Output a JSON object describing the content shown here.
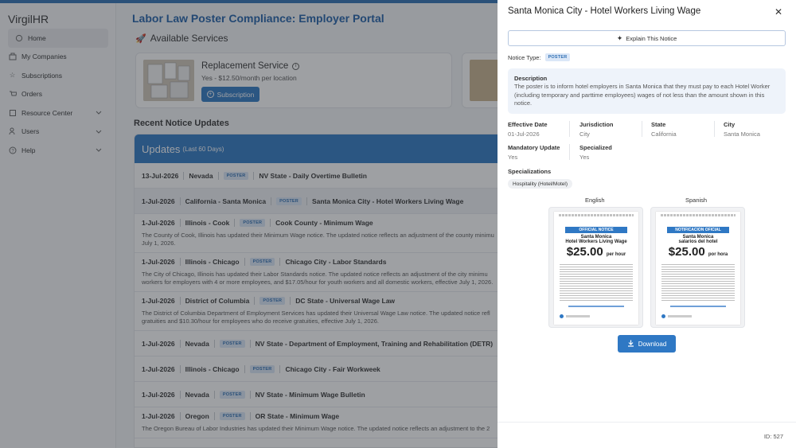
{
  "sidebar": {
    "brand": "VirgilHR",
    "items": [
      {
        "label": "Home",
        "icon": "home-icon",
        "active": true,
        "expandable": false
      },
      {
        "label": "My Companies",
        "icon": "building-icon",
        "active": false,
        "expandable": false
      },
      {
        "label": "Subscriptions",
        "icon": "star-icon",
        "active": false,
        "expandable": false
      },
      {
        "label": "Orders",
        "icon": "cart-icon",
        "active": false,
        "expandable": false
      },
      {
        "label": "Resource Center",
        "icon": "book-icon",
        "active": false,
        "expandable": true
      },
      {
        "label": "Users",
        "icon": "users-icon",
        "active": false,
        "expandable": true
      },
      {
        "label": "Help",
        "icon": "help-icon",
        "active": false,
        "expandable": true
      }
    ]
  },
  "main": {
    "title": "Labor Law Poster Compliance: Employer Portal",
    "available_services": "Available Services",
    "service": {
      "title": "Replacement Service",
      "price": "Yes - $12.50/month per location",
      "button": "Subscription"
    },
    "recent_title": "Recent Notice Updates",
    "updates_title": "Updates",
    "updates_sub": "(Last 60 Days)",
    "rows": [
      {
        "date": "13-Jul-2026",
        "loc": "Nevada",
        "badge": "POSTER",
        "title": "NV State - Daily Overtime Bulletin",
        "desc": []
      },
      {
        "date": "1-Jul-2026",
        "loc": "California - Santa Monica",
        "badge": "POSTER",
        "title": "Santa Monica City - Hotel Workers Living Wage",
        "desc": [],
        "highlight": true
      },
      {
        "date": "1-Jul-2026",
        "loc": "Illinois - Cook",
        "badge": "POSTER",
        "title": "Cook County - Minimum Wage",
        "desc": [
          "The County of Cook, Illinois has updated their Minimum Wage notice. The updated notice reflects an adjustment of the county minimu",
          "July 1, 2026."
        ]
      },
      {
        "date": "1-Jul-2026",
        "loc": "Illinois - Chicago",
        "badge": "POSTER",
        "title": "Chicago City - Labor Standards",
        "desc": [
          "The City of Chicago, Illinois has updated their Labor Standards notice. The updated notice reflects an adjustment of the city minimu",
          "workers for employers with 4 or more employees, and $17.05/hour for youth workers and all domestic workers, effective July 1, 2026."
        ]
      },
      {
        "date": "1-Jul-2026",
        "loc": "District of Columbia",
        "badge": "POSTER",
        "title": "DC State - Universal Wage Law",
        "desc": [
          "The District of Columbia Department of Employment Services has updated their Universal Wage Law notice. The updated notice refl",
          "gratuities and $10.30/hour for employees who do receive gratuities, effective July 1, 2026."
        ]
      },
      {
        "date": "1-Jul-2026",
        "loc": "Nevada",
        "badge": "POSTER",
        "title": "NV State - Department of Employment, Training and Rehabilitation (DETR)",
        "desc": []
      },
      {
        "date": "1-Jul-2026",
        "loc": "Illinois - Chicago",
        "badge": "POSTER",
        "title": "Chicago City - Fair Workweek",
        "desc": []
      },
      {
        "date": "1-Jul-2026",
        "loc": "Nevada",
        "badge": "POSTER",
        "title": "NV State - Minimum Wage Bulletin",
        "desc": []
      },
      {
        "date": "1-Jul-2026",
        "loc": "Oregon",
        "badge": "POSTER",
        "title": "OR State - Minimum Wage",
        "desc": [
          "The Oregon Bureau of Labor Industries has updated their Minimum Wage notice. The updated notice reflects an adjustment to the 2"
        ]
      }
    ]
  },
  "panel": {
    "title": "Santa Monica City - Hotel Workers Living Wage",
    "explain": "Explain This Notice",
    "notice_type_label": "Notice Type:",
    "notice_type": "POSTER",
    "description_label": "Description",
    "description": "The poster is to inform hotel employers in Santa Monica that they must pay to each Hotel Worker (including temporary and parttime employees) wages of not less than the amount shown in this notice.",
    "effective_label": "Effective Date",
    "effective": "01-Jul-2026",
    "jurisdiction_label": "Jurisdiction",
    "jurisdiction": "City",
    "state_label": "State",
    "state": "California",
    "city_label": "City",
    "city": "Santa Monica",
    "mandatory_label": "Mandatory Update",
    "mandatory": "Yes",
    "specialized_label": "Specialized",
    "specialized": "Yes",
    "specializations_label": "Specializations",
    "specialization": "Hospitality (Hotel/Motel)",
    "english_label": "English",
    "spanish_label": "Spanish",
    "poster_en": {
      "banner": "OFFICIAL NOTICE",
      "city": "Santa Monica",
      "sub": "Hotel Workers Living Wage",
      "amount": "25.00",
      "per": "per hour"
    },
    "poster_es": {
      "banner": "NOTIFICACION OFICIAL",
      "city": "Santa Monica",
      "sub": "salarios del hotel",
      "amount": "25.00",
      "per": "por hora"
    },
    "download": "Download",
    "id": "ID: 527"
  },
  "colors": {
    "accent": "#2f78c4",
    "title_blue": "#1f5fa8",
    "badge_bg": "#dbe7f7"
  }
}
